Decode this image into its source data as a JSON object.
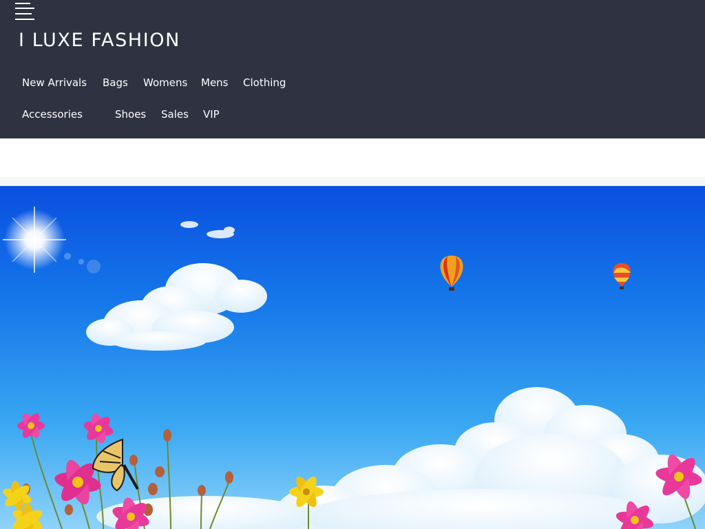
{
  "header": {
    "title": "I LUXE FASHION",
    "background_color": "#2e3241",
    "menu_icon": "hamburger-menu-icon"
  },
  "nav": {
    "items": [
      {
        "label": "New Arrivals"
      },
      {
        "label": "Bags"
      },
      {
        "label": "Womens"
      },
      {
        "label": "Mens"
      },
      {
        "label": "Clothing"
      },
      {
        "label": "Accessories"
      },
      {
        "label": "Shoes"
      },
      {
        "label": "Sales"
      },
      {
        "label": "VIP"
      }
    ]
  },
  "hero": {
    "image": "sky-with-clouds-balloons-and-flowers",
    "sky_color": "#1e8ff0"
  }
}
